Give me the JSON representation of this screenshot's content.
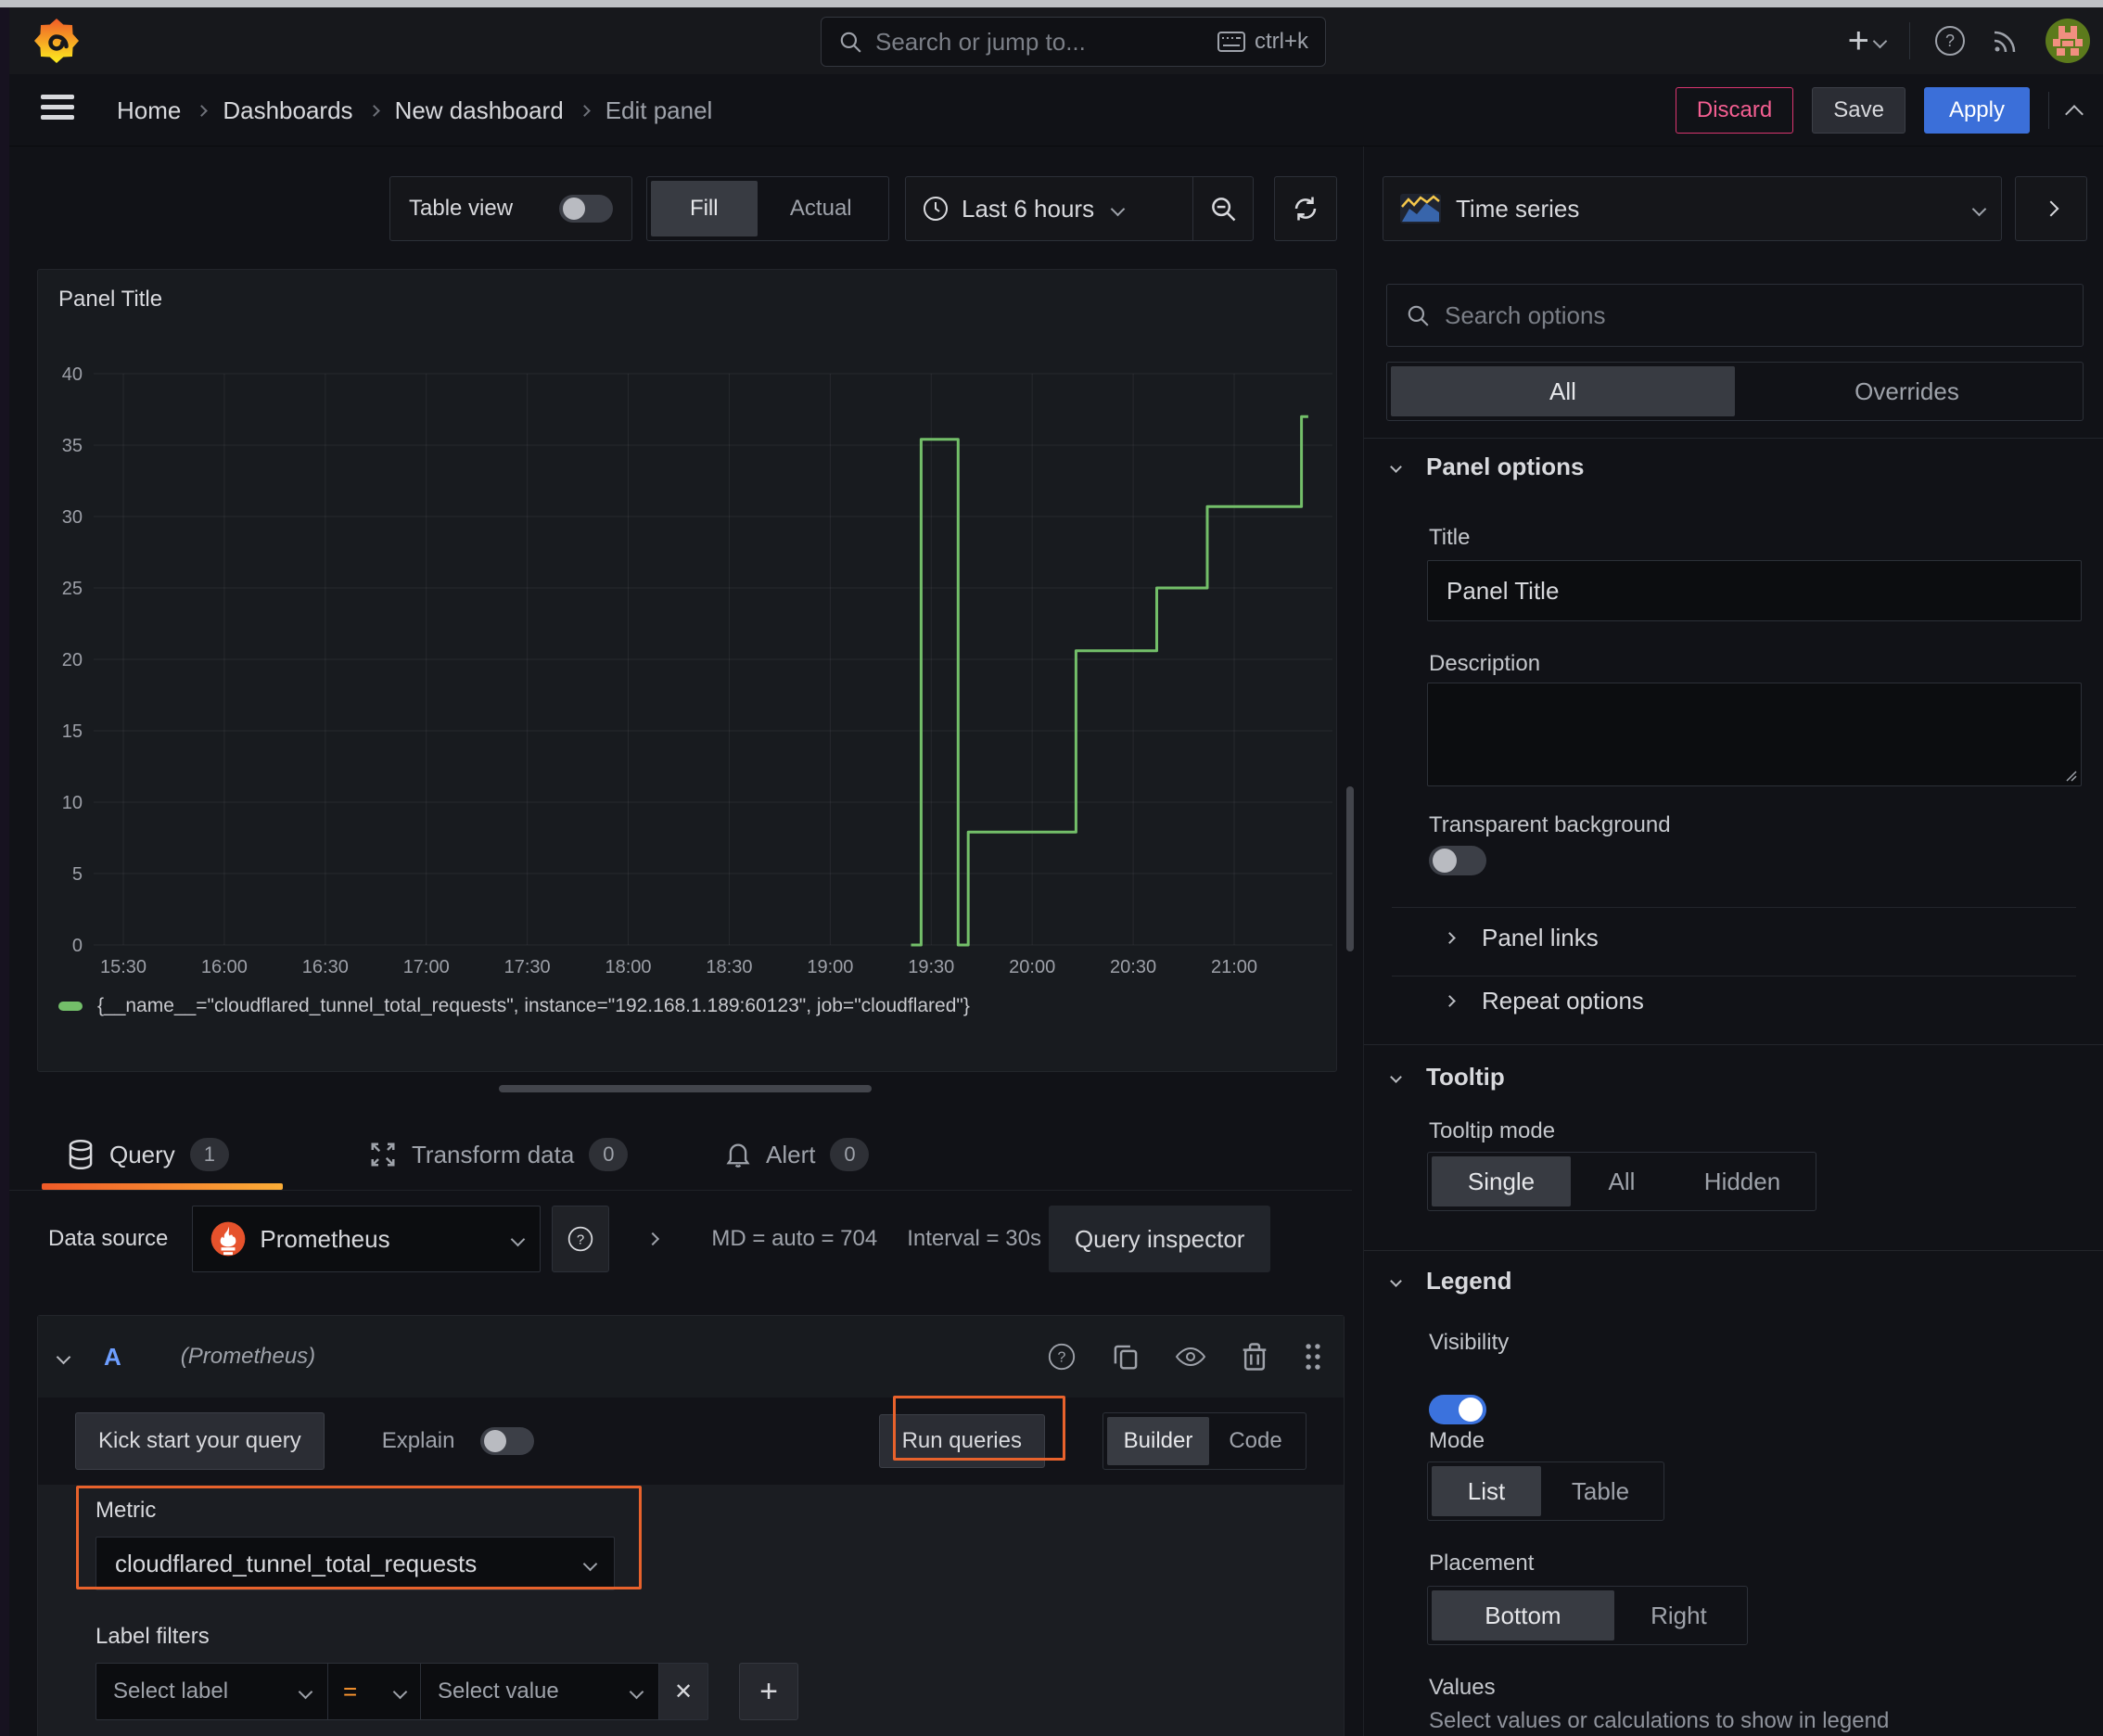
{
  "topnav": {
    "search_placeholder": "Search or jump to...",
    "shortcut": "ctrl+k",
    "add_label": "+"
  },
  "breadcrumb": {
    "items": [
      "Home",
      "Dashboards",
      "New dashboard",
      "Edit panel"
    ]
  },
  "actions": {
    "discard": "Discard",
    "save": "Save",
    "apply": "Apply"
  },
  "toolbar": {
    "table_view": "Table view",
    "fill": "Fill",
    "actual": "Actual",
    "time_range": "Last 6 hours"
  },
  "panel": {
    "title": "Panel Title"
  },
  "chart_data": {
    "type": "line",
    "title": "Panel Title",
    "grid": true,
    "legend_position": "bottom",
    "xlabel": "",
    "ylabel": "",
    "ylim": [
      0,
      40
    ],
    "y_ticks": [
      0,
      5,
      10,
      15,
      20,
      25,
      30,
      35,
      40
    ],
    "x_ticks": [
      "15:30",
      "16:00",
      "16:30",
      "17:00",
      "17:30",
      "18:00",
      "18:30",
      "19:00",
      "19:30",
      "20:00",
      "20:30",
      "21:00"
    ],
    "series": [
      {
        "name": "{__name__=\"cloudflared_tunnel_total_requests\", instance=\"192.168.1.189:60123\", job=\"cloudflared\"}",
        "color": "#73BF69",
        "steps": [
          {
            "t": "19:24",
            "v": 0
          },
          {
            "t": "19:27",
            "v": 35.4
          },
          {
            "t": "19:38",
            "v": 0
          },
          {
            "t": "19:41",
            "v": 7.9
          },
          {
            "t": "20:13",
            "v": 20.6
          },
          {
            "t": "20:37",
            "v": 25
          },
          {
            "t": "20:52",
            "v": 30.7
          },
          {
            "t": "21:20",
            "v": 37
          }
        ],
        "end": "21:22"
      }
    ]
  },
  "tabs": {
    "query": {
      "label": "Query",
      "badge": "1"
    },
    "transform": {
      "label": "Transform data",
      "badge": "0"
    },
    "alert": {
      "label": "Alert",
      "badge": "0"
    }
  },
  "datasource": {
    "label": "Data source",
    "name": "Prometheus",
    "md": "MD = auto = 704",
    "interval": "Interval = 30s",
    "inspector": "Query inspector"
  },
  "query": {
    "refid": "A",
    "ds_hint": "(Prometheus)",
    "kickstart": "Kick start your query",
    "explain": "Explain",
    "run": "Run queries",
    "builder": "Builder",
    "code": "Code",
    "metric_label": "Metric",
    "metric_value": "cloudflared_tunnel_total_requests",
    "label_filters": "Label filters",
    "select_label": "Select label",
    "operator": "=",
    "select_value": "Select value",
    "remove_glyph": "✕",
    "add_glyph": "+"
  },
  "options": {
    "viz": "Time series",
    "search_placeholder": "Search options",
    "tab_all": "All",
    "tab_overrides": "Overrides",
    "panel_options": {
      "heading": "Panel options",
      "title_label": "Title",
      "title_value": "Panel Title",
      "description_label": "Description",
      "transparent": "Transparent background"
    },
    "links": "Panel links",
    "repeat": "Repeat options",
    "tooltip": {
      "heading": "Tooltip",
      "mode_label": "Tooltip mode",
      "single": "Single",
      "all": "All",
      "hidden": "Hidden"
    },
    "legend": {
      "heading": "Legend",
      "visibility": "Visibility",
      "mode": "Mode",
      "list": "List",
      "table": "Table",
      "placement": "Placement",
      "bottom": "Bottom",
      "right": "Right",
      "values": "Values",
      "values_hint": "Select values or calculations to show in legend"
    }
  },
  "colors": {
    "accent_orange": "#e8622c",
    "line_green": "#73BF69",
    "blue": "#3b6fd9",
    "pink": "#f55f92"
  }
}
